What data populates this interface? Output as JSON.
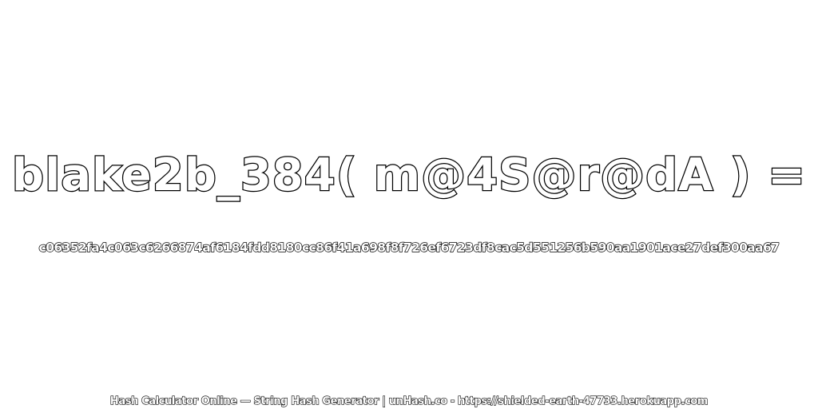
{
  "title": "blake2b_384( m@4S@r@dA ) =",
  "hash": "c06352fa4c063c6266874af6184fdd8180cc86f41a698f8f726ef6723df8cac5d551256b590aa1901ace27def300aa67",
  "footer": "Hash Calculator Online — String Hash Generator | unHash.co - https://shielded-earth-47733.herokuapp.com",
  "colors": {
    "background": "#ffffff",
    "text_fill": "#ffffff",
    "text_outline": "#000000"
  }
}
